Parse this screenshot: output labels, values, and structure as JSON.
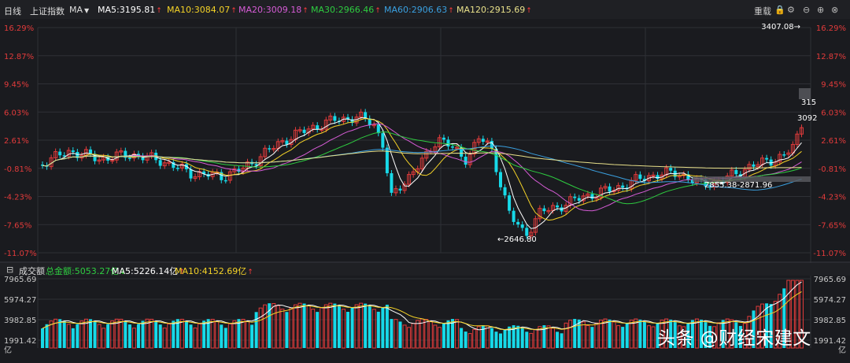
{
  "header": {
    "period_label": "日线",
    "symbol": "上证指数",
    "indicator_selector": "MA",
    "ma": [
      {
        "label": "MA5:3195.81",
        "color": "#ffffff"
      },
      {
        "label": "MA10:3084.07",
        "color": "#f5d327"
      },
      {
        "label": "MA20:3009.18",
        "color": "#d65cd6"
      },
      {
        "label": "MA30:2966.46",
        "color": "#2ecc40"
      },
      {
        "label": "MA60:2906.63",
        "color": "#3aa0e0"
      },
      {
        "label": "MA120:2915.69",
        "color": "#e8e08a"
      }
    ],
    "restore_label": "重载",
    "icons": [
      "lock-icon",
      "settings-icon",
      "minus-circle-icon",
      "plus-circle-icon",
      "close-circle-icon"
    ]
  },
  "price_axis": {
    "ticks": [
      "16.29%",
      "12.87%",
      "9.45%",
      "6.03%",
      "2.61%",
      "-0.81%",
      "-4.23%",
      "-7.65%",
      "-11.07%"
    ]
  },
  "annotations": {
    "high": "3407.08→",
    "low": "←2646.80",
    "range": "2855.38-2871.96",
    "right_a": "315",
    "right_b": "3092"
  },
  "volume_header": {
    "title": "成交额",
    "total": "总金额:5053.27亿",
    "ma5": "MA5:5226.14亿",
    "ma10": "MA10:4152.69亿"
  },
  "volume_axis": {
    "ticks": [
      "7965.69",
      "5974.27",
      "3982.85",
      "1991.42"
    ],
    "unit": "亿"
  },
  "colors": {
    "up": "#e23b3b",
    "down": "#17d9e8",
    "background": "#1a1b1f",
    "grid": "#2e3036"
  },
  "watermark": "头条 @财经宋建文"
}
